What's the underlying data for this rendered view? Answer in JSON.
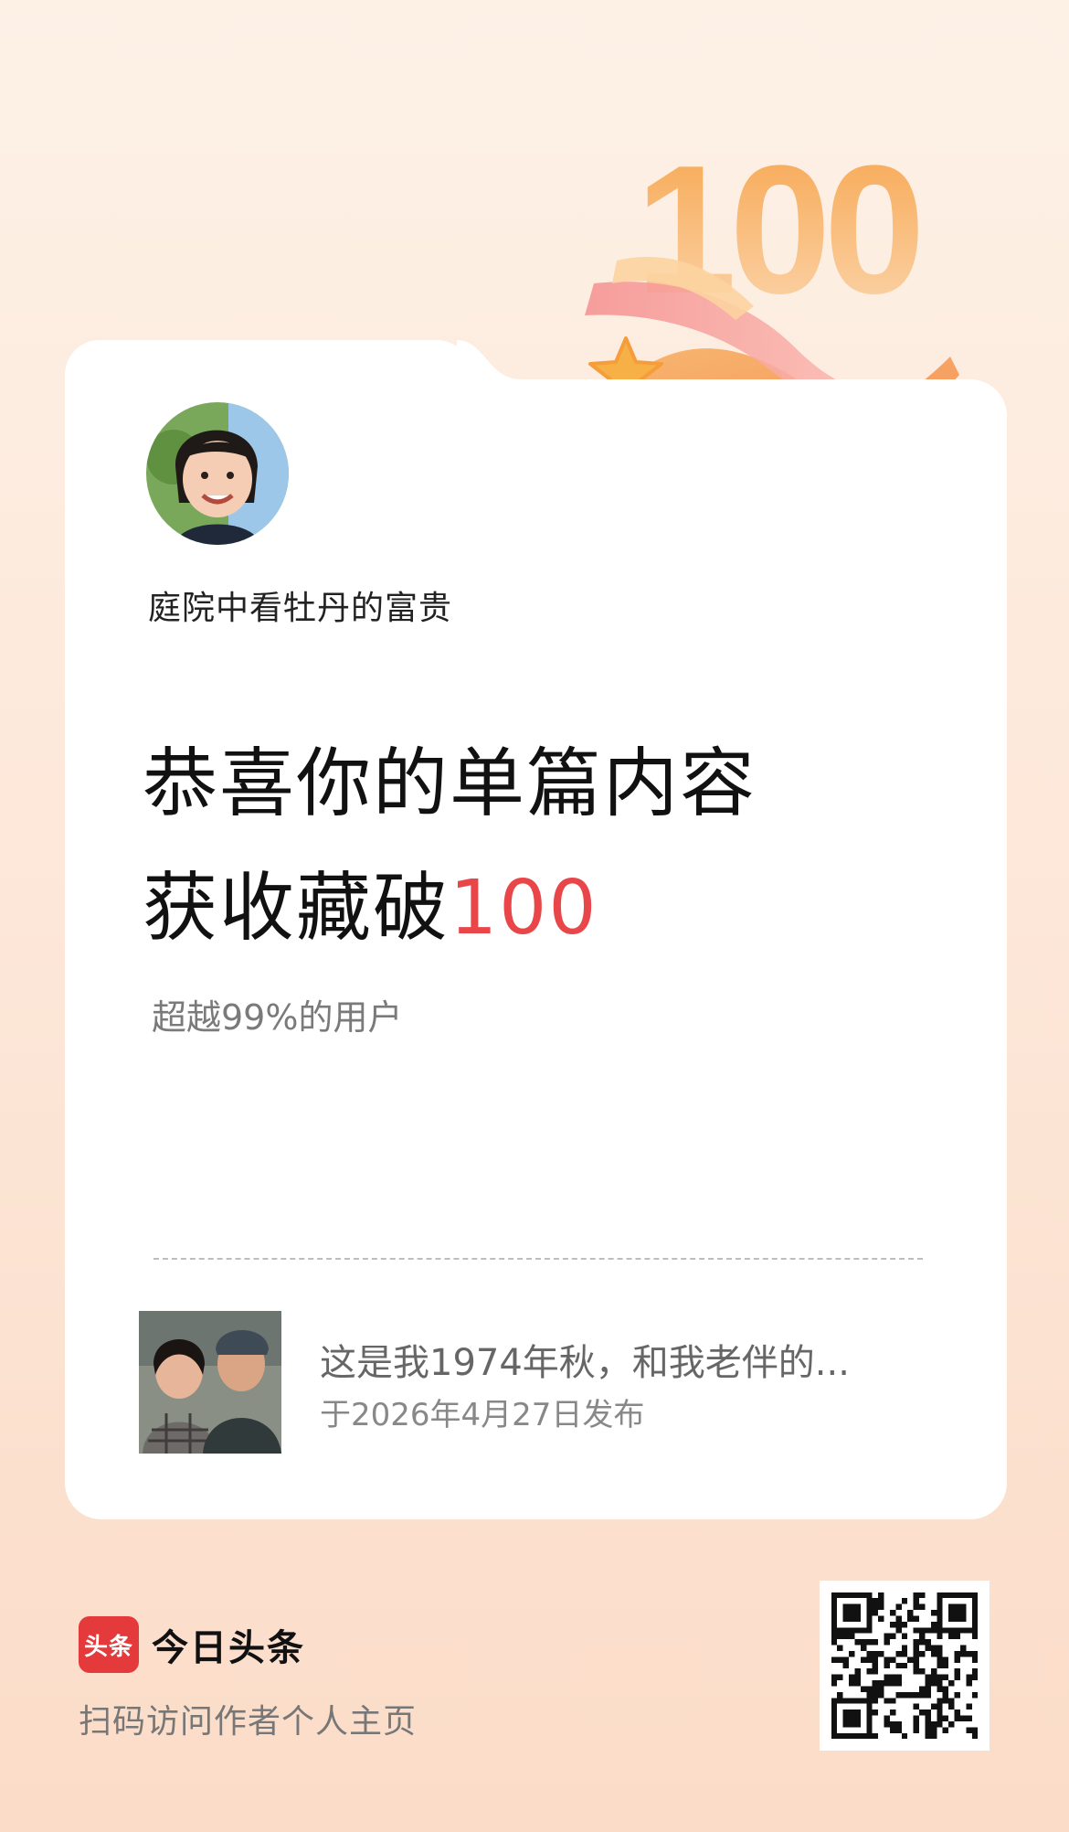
{
  "hero": {
    "badge_number": "100"
  },
  "author": {
    "name": "庭院中看牡丹的富贵"
  },
  "headline": {
    "line1": "恭喜你的单篇内容",
    "line2_prefix": "获收藏破",
    "line2_number": "100"
  },
  "ranking": {
    "text": "超越99%的用户"
  },
  "article": {
    "title": "这是我1974年秋，和我老伴的...",
    "published": "于2026年4月27日发布"
  },
  "footer": {
    "logo_text": "头条",
    "brand_name": "今日头条",
    "scan_hint": "扫码访问作者个人主页"
  },
  "colors": {
    "accent": "#e9464a",
    "brand_red": "#e43a3c",
    "badge_orange": "#f7a24a"
  },
  "icons": [
    "star-icon",
    "qr-code-icon"
  ]
}
